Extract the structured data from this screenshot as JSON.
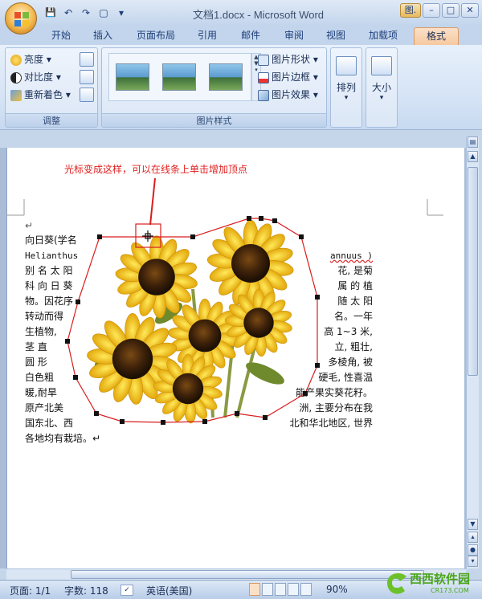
{
  "titlebar": {
    "title": "文档1.docx - Microsoft Word",
    "context_btn": "图.",
    "minimize": "–",
    "maximize": "□",
    "close": "✕"
  },
  "qat": {
    "save": "💾",
    "undo": "↶",
    "redo": "↷",
    "new": "▢",
    "more": "▾"
  },
  "tabs": [
    "开始",
    "插入",
    "页面布局",
    "引用",
    "邮件",
    "审阅",
    "视图",
    "加载项",
    "格式"
  ],
  "ribbon": {
    "adjust": {
      "label": "调整",
      "brightness": "亮度",
      "contrast": "对比度",
      "recolor": "重新着色"
    },
    "picture_styles": {
      "label": "图片样式",
      "shape": "图片形状",
      "border": "图片边框",
      "effects": "图片效果"
    },
    "arrange": {
      "label": "排列"
    },
    "size": {
      "label": "大小"
    }
  },
  "annotation": "光标变成这样，可以在线条上单击增加顶点",
  "document": {
    "para_mark": "↵",
    "left_lines": [
      "向日葵(学名",
      "Helianthus",
      "别 名 太 阳",
      "科 向 日 葵",
      "物。因花序",
      "转动而得",
      "生植物,",
      "茎  直",
      "圆  形",
      "白色粗",
      "暖,耐旱",
      "原产北美",
      "国东北、西",
      "各地均有栽培。↵"
    ],
    "right_lines": [
      "annuus )",
      "花, 是菊",
      "属 的 植",
      "随 太 阳",
      "名。一年",
      "高 1~3 米,",
      "立, 粗壮,",
      "多棱角, 被",
      "硬毛, 性喜温",
      "能产果实葵花籽。",
      "洲, 主要分布在我",
      "北和华北地区, 世界"
    ]
  },
  "status": {
    "page": "页面: 1/1",
    "words": "字数: 118",
    "language": "英语(美国)",
    "zoom": "90%"
  },
  "watermark": {
    "text": "西西软件园",
    "sub": "CR173.COM"
  }
}
